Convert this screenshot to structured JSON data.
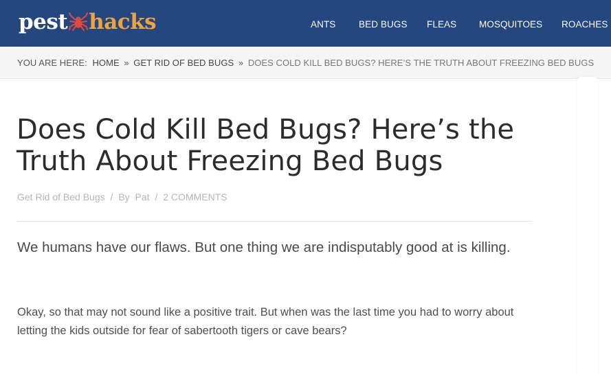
{
  "header": {
    "logo_part1": "pest",
    "logo_part2": "hacks",
    "logo_icon": "spider-icon",
    "nav": [
      {
        "label": "ANTS"
      },
      {
        "label": "BED BUGS"
      },
      {
        "label": "FLEAS"
      },
      {
        "label": "MOSQUITOES"
      },
      {
        "label": "ROACHES"
      }
    ],
    "colors": {
      "background": "#244780",
      "logo_accent": "#f2a23a",
      "bug": "#e5483b"
    }
  },
  "breadcrumb": {
    "prefix": "YOU ARE HERE:",
    "items": [
      "HOME",
      "GET RID OF BED BUGS"
    ],
    "separator": "»",
    "current": "DOES COLD KILL BED BUGS? HERE’S THE TRUTH ABOUT FREEZING BED BUGS"
  },
  "article": {
    "title": "Does Cold Kill Bed Bugs? Here’s the Truth About Freezing Bed Bugs",
    "meta": {
      "category": "Get Rid of Bed Bugs",
      "author_prefix": "By",
      "author": "Pat",
      "comments": "2 COMMENTS",
      "separator": "/"
    },
    "lead": "We humans have our flaws. But one thing we are indisputably good at is killing.",
    "paragraph": "Okay, so that may not sound like a positive trait. But when was the last time you had to worry about letting the kids outside for fear of sabertooth tigers or cave bears?"
  }
}
